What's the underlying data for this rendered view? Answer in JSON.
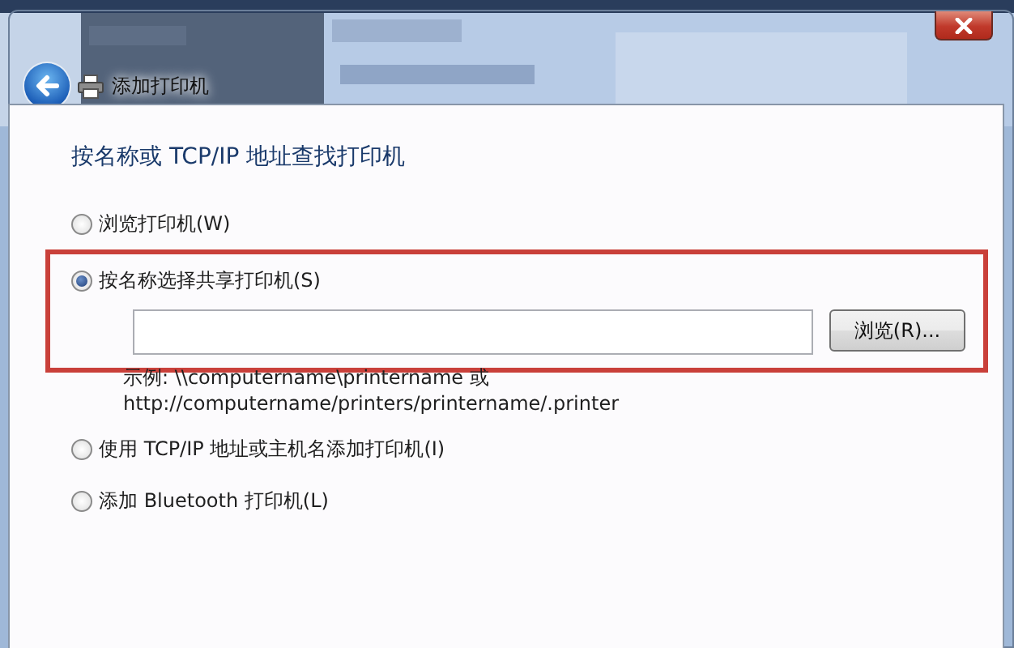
{
  "window": {
    "title": "添加打印机"
  },
  "heading": "按名称或 TCP/IP 地址查找打印机",
  "options": [
    {
      "label": "浏览打印机(W)",
      "selected": false,
      "highlighted": false
    },
    {
      "label": "按名称选择共享打印机(S)",
      "selected": true,
      "highlighted": true,
      "text_field": true,
      "browse_button": "浏览(R)...",
      "example_lines": [
        "示例: \\\\computername\\printername 或",
        "http://computername/printers/printername/.printer"
      ]
    },
    {
      "label": "使用 TCP/IP 地址或主机名添加打印机(I)",
      "selected": false,
      "highlighted": false
    },
    {
      "label": "添加 Bluetooth 打印机(L)",
      "selected": false,
      "highlighted": false
    }
  ]
}
